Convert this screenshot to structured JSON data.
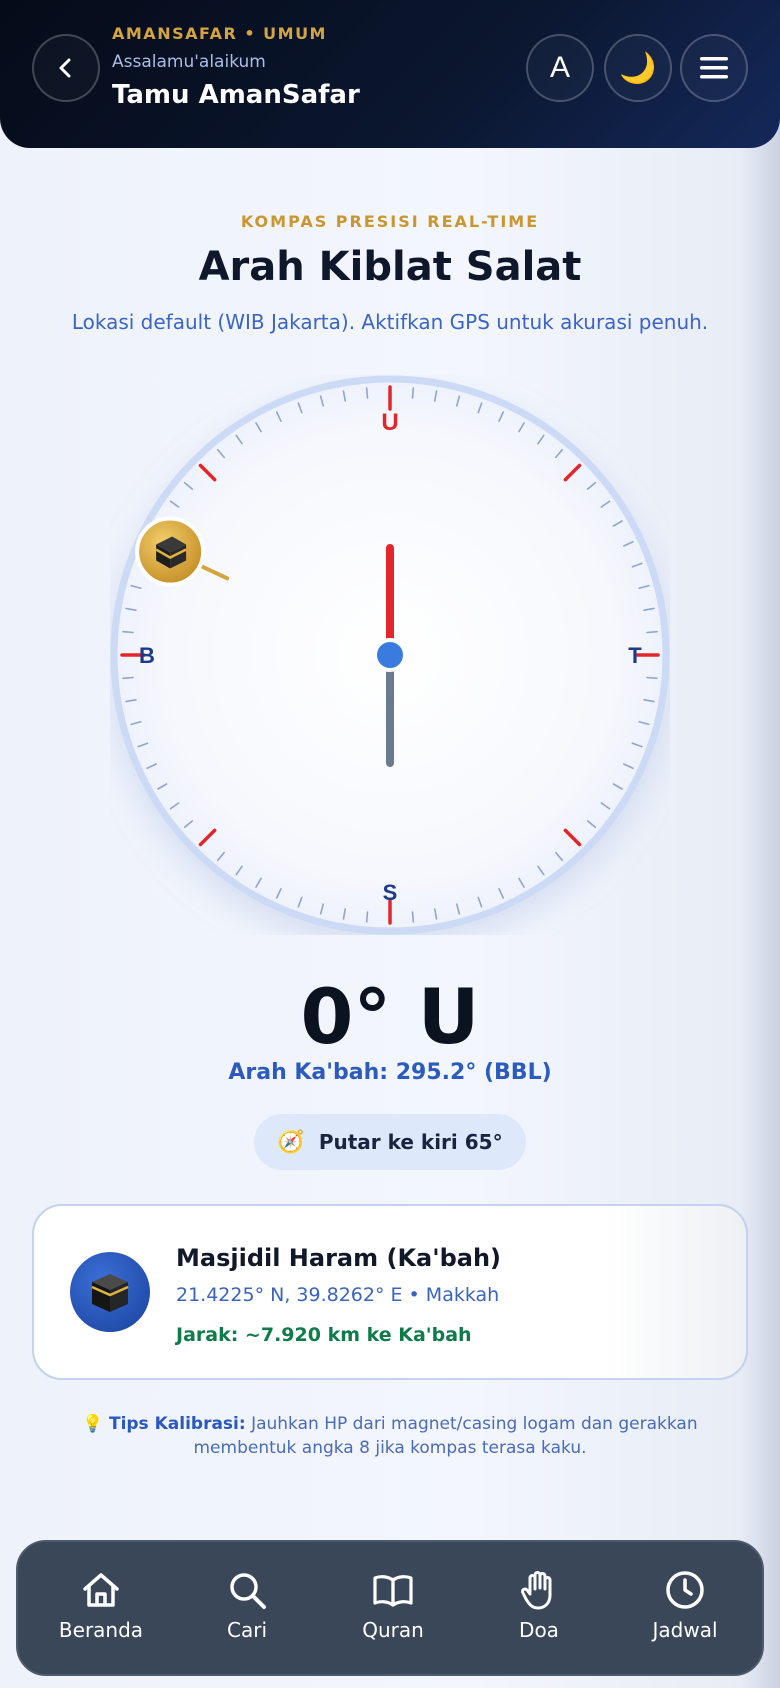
{
  "header": {
    "brand_tag": "AMANSAFAR • UMUM",
    "greeting": "Assalamu'alaikum",
    "user_name": "Tamu AmanSafar",
    "lang_label": "A",
    "theme_icon": "🌙"
  },
  "main": {
    "eyebrow": "KOMPAS PRESISI REAL-TIME",
    "title": "Arah Kiblat Salat",
    "subtitle": "Lokasi default (WIB Jakarta). Aktifkan GPS untuk akurasi penuh."
  },
  "compass": {
    "heading_deg": 0,
    "qibla_deg": 295.2,
    "cardinals": {
      "north": "U",
      "east": "T",
      "south": "S",
      "west": "B"
    },
    "colors": {
      "north_needle": "#e3262b",
      "south_needle": "#6b7a90",
      "hub": "#3a7be0",
      "kaaba_marker": "#d4a440"
    }
  },
  "readout": {
    "heading_text": "0° U",
    "kaaba_direction": "Arah Ka'bah: 295.2° (BBL)",
    "turn_icon": "🧭",
    "turn_instruction": "Putar ke kiri 65°"
  },
  "mosque_card": {
    "name": "Masjidil Haram (Ka'bah)",
    "coords": "21.4225° N, 39.8262° E • Makkah",
    "distance": "Jarak: ~7.920 km ke Ka'bah"
  },
  "tips": {
    "icon": "💡",
    "label": "Tips Kalibrasi:",
    "text": "Jauhkan HP dari magnet/casing logam dan gerakkan membentuk angka 8 jika kompas terasa kaku."
  },
  "bottom_nav": {
    "items": [
      {
        "label": "Beranda",
        "icon": "home-icon"
      },
      {
        "label": "Cari",
        "icon": "search-icon"
      },
      {
        "label": "Quran",
        "icon": "book-icon"
      },
      {
        "label": "Doa",
        "icon": "hand-icon"
      },
      {
        "label": "Jadwal",
        "icon": "clock-icon"
      }
    ]
  }
}
